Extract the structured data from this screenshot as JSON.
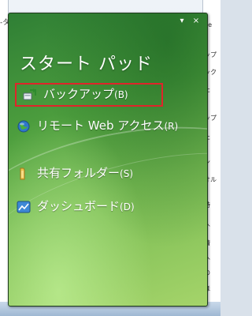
{
  "gadget": {
    "title": "スタート パッド",
    "controls": {
      "options_glyph": "▾",
      "close_glyph": "×"
    },
    "items": [
      {
        "label": "バックアップ",
        "key": "(B)",
        "icon": "backup-icon",
        "selected": true
      },
      {
        "label": "リモート Web アクセス",
        "key": "(R)",
        "icon": "remote-web-access-icon",
        "selected": false
      },
      {
        "label": "共有フォルダー",
        "key": "(S)",
        "icon": "shared-folder-icon",
        "selected": false
      },
      {
        "label": "ダッシュボード",
        "key": "(D)",
        "icon": "dashboard-icon",
        "selected": false
      }
    ]
  },
  "background": {
    "top_left_text": "-タ",
    "right_snippets": [
      "Se",
      "ップ",
      "ック",
      "た",
      "ップ",
      "た",
      "ン",
      "オル",
      "時",
      "人",
      "情",
      "人",
      "の",
      "ほ"
    ]
  },
  "colors": {
    "gadget_green_dark": "#2f7f35",
    "gadget_green_light": "#a5d46a",
    "highlight_red": "#e0242a"
  }
}
